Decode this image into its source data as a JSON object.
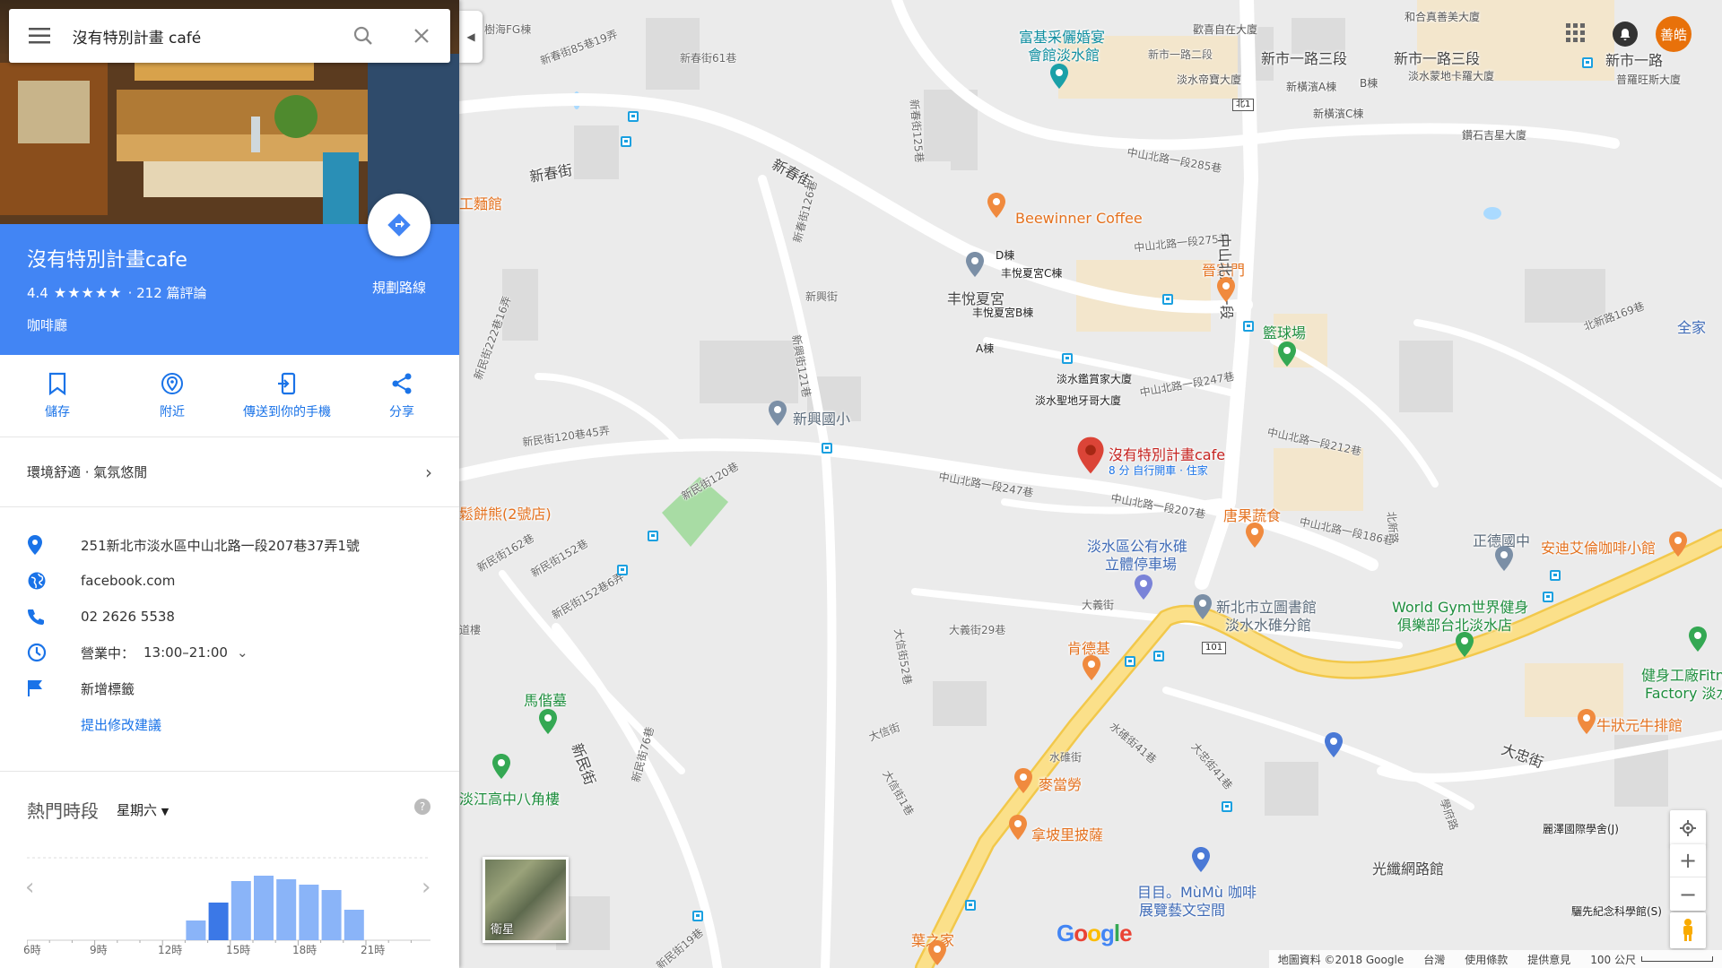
{
  "search": {
    "value": "沒有特別計畫 café"
  },
  "place": {
    "name": "沒有特別計畫cafe",
    "rating": "4.4",
    "stars": "★★★★★",
    "review_count": "· 212 篇評論",
    "category": "咖啡廳",
    "directions_label": "規劃路線"
  },
  "actions": [
    {
      "label": "儲存",
      "icon": "bookmark-icon"
    },
    {
      "label": "附近",
      "icon": "nearby-pin-icon"
    },
    {
      "label": "傳送到你的手機",
      "icon": "send-to-phone-icon"
    },
    {
      "label": "分享",
      "icon": "share-icon"
    }
  ],
  "summary": "環境舒適 · 氣氛悠閒",
  "info": {
    "address": "251新北市淡水區中山北路一段207巷37弄1號",
    "website": "facebook.com",
    "phone": "02 2626 5538",
    "hours_status": "營業中：",
    "hours": "13:00–21:00",
    "add_label": "新增標籤",
    "suggest_edit": "提出修改建議"
  },
  "popular_times": {
    "title": "熱門時段",
    "day": "星期六",
    "hours": [
      "6時",
      "9時",
      "12時",
      "15時",
      "18時",
      "21時"
    ],
    "levels": [
      0,
      0,
      0,
      0,
      0,
      0,
      0,
      0.22,
      0.42,
      0.66,
      0.72,
      0.68,
      0.62,
      0.56,
      0.34,
      0,
      0,
      0
    ],
    "current_index": 8
  },
  "map": {
    "target_label": "沒有特別計畫cafe",
    "target_sub": "8 分 自行開車 · 住家",
    "labels": {
      "l1": "富基采儷婚宴",
      "l2": "會館淡水館",
      "l3": "新市一路二段",
      "l4": "新市一路三段",
      "l5": "新市一路三段",
      "l6": "新市一路",
      "l7": "歡喜自在大廈",
      "l8": "和合真善美大廈",
      "l9": "淡水帝寶大廈",
      "l10": "新橫濱A棟",
      "l11": "B棟",
      "l12": "淡水蒙地卡羅大廈",
      "l13": "普羅旺斯大廈",
      "l14": "新橫濱C棟",
      "l15": "鑽石吉星大廈",
      "l16": "中山北路一段285巷",
      "l17": "Beewinner Coffee",
      "l18": "中山北路一段275巷",
      "l19": "晉家門",
      "l20": "中山北路一段",
      "l21": "籃球場",
      "l22": "北新路169巷",
      "l23": "全家",
      "l24": "D棟",
      "l25": "丰悅夏宮C棟",
      "l26": "丰悅夏宮",
      "l27": "丰悅夏宮B棟",
      "l28": "A棟",
      "l29": "淡水鑑賞家大廈",
      "l30": "淡水聖地牙哥大廈",
      "l31": "新興國小",
      "l32": "中山北路一段247巷",
      "l33": "中山北路一段212巷",
      "l34": "中山北路一段207巷",
      "l35": "唐果蔬食",
      "l36": "中山北路一段186巷",
      "l37": "正德國中",
      "l38": "安迪艾倫咖啡小館",
      "l39": "淡水區公有水碓",
      "l40": "立體停車場",
      "l41": "新北市立圖書館",
      "l42": "淡水水碓分館",
      "l43": "World Gym世界健身",
      "l44": "俱樂部台北淡水店",
      "l45": "肯德基",
      "l46": "大義街",
      "l47": "大義街29巷",
      "l48": "馬偕墓",
      "l49": "健身工廠Fitn",
      "l50": "Factory 淡水",
      "l51": "牛狀元牛排館",
      "l52": "麥當勞",
      "l53": "拿坡里披薩",
      "l54": "大忠街",
      "l55": "淡江高中八角樓",
      "l56": "鬆餅熊(2號店)",
      "l57": "麗澤國際學舍(J)",
      "l58": "光纖網路館",
      "l59": "目目。MùMù 咖啡",
      "l60": "展覽藝文空間",
      "l61": "驪先紀念科學館(S)",
      "l62": "葉之家",
      "l63": "新春街",
      "l64": "新春街",
      "l65": "新興街",
      "l66": "新民街120巷45弄",
      "l67": "新民街120巷",
      "l68": "新民街",
      "l69": "新民街162巷",
      "l70": "新民街152巷",
      "l71": "工麵館",
      "l72": "樹海FG棟",
      "l73": "新春街61巷",
      "l74": "新春街85巷19弄",
      "l75": "新春街126巷",
      "l76": "新興街121巷",
      "l77": "大信街",
      "l78": "大信街52巷",
      "l79": "水碓街",
      "l80": "水碓街41巷",
      "l81": "大忠街41巷",
      "l82": "學府路",
      "l83": "道樓",
      "l84": "北新路",
      "l85": "新民街76巷",
      "l86": "新民街19巷",
      "l87": "新春街125巷",
      "l88": "新民街222巷16弄",
      "l89": "新民街152巷6弄",
      "l90": "大信街1巷",
      "l91": "中山北路一段247巷"
    },
    "shield_1": "北1",
    "shield_2": "101",
    "satellite_label": "衛星",
    "google_logo": "Google",
    "user_avatar": "善皓",
    "footer": [
      "地圖資料 ©2018 Google",
      "台灣",
      "使用條款",
      "提供意見",
      "100 公尺"
    ],
    "colors": {
      "accent": "#4285f4",
      "highway": "#f9d870",
      "pin": "#db4437"
    }
  }
}
